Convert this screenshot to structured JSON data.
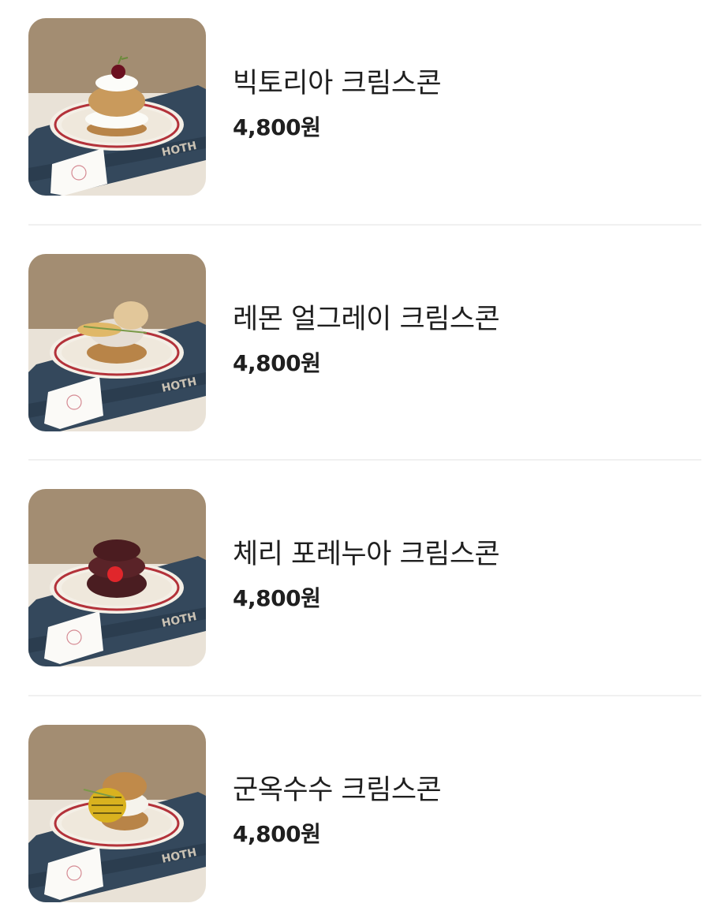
{
  "menu": {
    "items": [
      {
        "name": "빅토리아 크림스콘",
        "price": "4,800원",
        "topping": "cherry"
      },
      {
        "name": "레몬 얼그레이 크림스콘",
        "price": "4,800원",
        "topping": "lemon"
      },
      {
        "name": "체리 포레누아 크림스콘",
        "price": "4,800원",
        "topping": "chocolate-cherry"
      },
      {
        "name": "군옥수수 크림스콘",
        "price": "4,800원",
        "topping": "corn"
      }
    ]
  },
  "colors": {
    "wall": "#a38d72",
    "table": "#e8e1d6",
    "book": "#34485c",
    "plate_rim": "#b3323a",
    "text": "#1f1f1f",
    "divider": "#f0f0f0"
  }
}
